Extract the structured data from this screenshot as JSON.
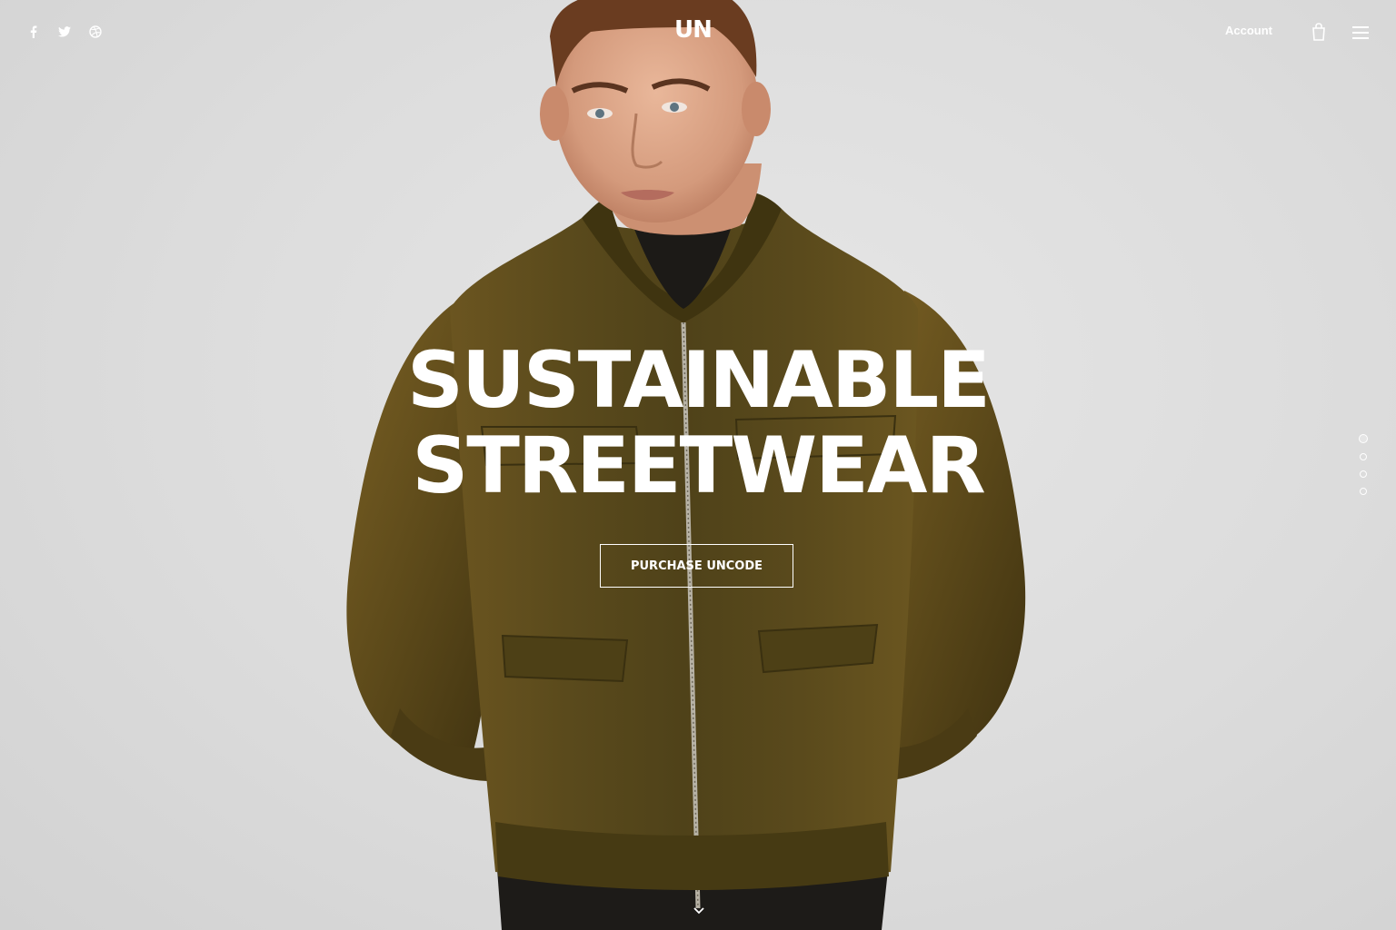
{
  "header": {
    "logo": "UN",
    "account_label": "Account",
    "social": [
      "facebook-icon",
      "twitter-icon",
      "dribbble-icon"
    ]
  },
  "hero": {
    "headline_line1": "SUSTAINABLE",
    "headline_line2": "STREETWEAR",
    "cta_label": "PURCHASE UNCODE",
    "slides": {
      "count": 4,
      "active": 1
    }
  },
  "colors": {
    "background": "#dcdcdc",
    "jacket": "#5a4a1e",
    "text": "#ffffff"
  }
}
